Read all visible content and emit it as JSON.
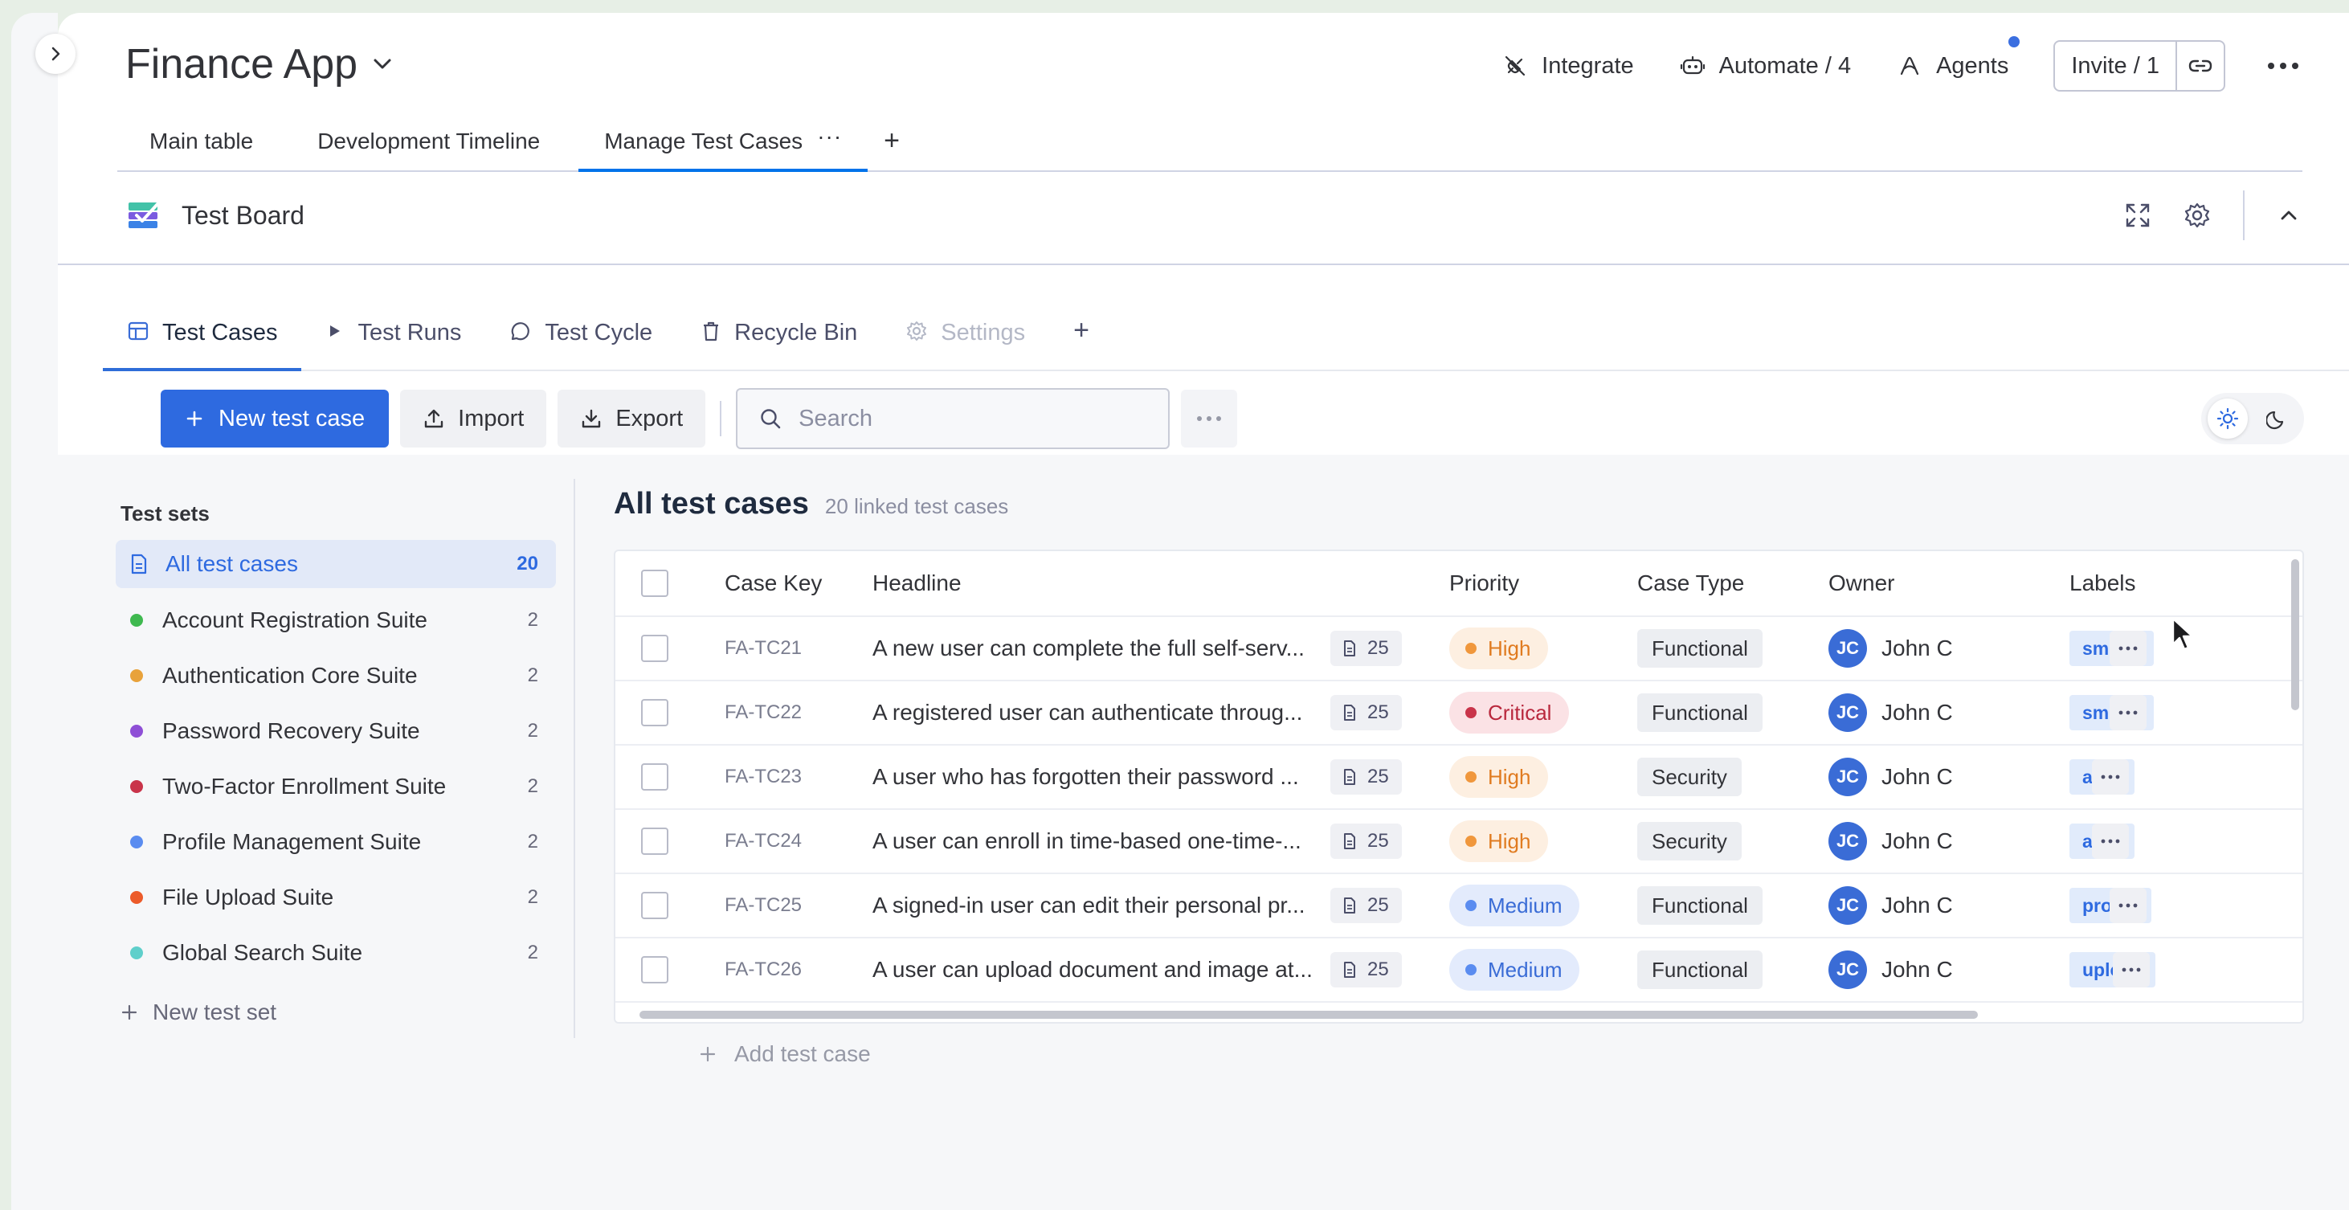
{
  "header": {
    "title": "Finance App",
    "actions": {
      "integrate": "Integrate",
      "automate": "Automate / 4",
      "agents": "Agents",
      "invite": "Invite / 1"
    }
  },
  "view_tabs": [
    {
      "label": "Main table"
    },
    {
      "label": "Development Timeline"
    },
    {
      "label": "Manage Test Cases"
    }
  ],
  "board": {
    "name": "Test Board"
  },
  "app_tabs": [
    {
      "label": "Test Cases"
    },
    {
      "label": "Test Runs"
    },
    {
      "label": "Test Cycle"
    },
    {
      "label": "Recycle Bin"
    },
    {
      "label": "Settings"
    }
  ],
  "toolbar": {
    "new_label": "New test case",
    "import_label": "Import",
    "export_label": "Export",
    "search_placeholder": "Search"
  },
  "sets": {
    "title": "Test sets",
    "items": [
      {
        "label": "All test cases",
        "count": "20",
        "color": ""
      },
      {
        "label": "Account Registration Suite",
        "count": "2",
        "color": "#3fb950"
      },
      {
        "label": "Authentication Core Suite",
        "count": "2",
        "color": "#e8a23b"
      },
      {
        "label": "Password Recovery Suite",
        "count": "2",
        "color": "#8e4fd6"
      },
      {
        "label": "Two-Factor Enrollment Suite",
        "count": "2",
        "color": "#c9344a"
      },
      {
        "label": "Profile Management Suite",
        "count": "2",
        "color": "#5a8cf0"
      },
      {
        "label": "File Upload Suite",
        "count": "2",
        "color": "#ec5b2a"
      },
      {
        "label": "Global Search Suite",
        "count": "2",
        "color": "#5fcfcb"
      }
    ],
    "new_label": "New test set"
  },
  "cases": {
    "title": "All test cases",
    "subtitle": "20 linked test cases",
    "columns": {
      "key": "Case Key",
      "headline": "Headline",
      "priority": "Priority",
      "type": "Case Type",
      "owner": "Owner",
      "labels": "Labels"
    },
    "rows": [
      {
        "key": "FA-TC21",
        "headline": "A new user can complete the full self-serv...",
        "steps": "25",
        "priority": "High",
        "prio_color": "#f0973c",
        "prio_bg": "#fdefe1",
        "prio_fg": "#e07b20",
        "type": "Functional",
        "owner_initials": "JC",
        "owner": "John C",
        "label": "smoke"
      },
      {
        "key": "FA-TC22",
        "headline": "A registered user can authenticate throug...",
        "steps": "25",
        "priority": "Critical",
        "prio_color": "#c9344a",
        "prio_bg": "#fbe2e5",
        "prio_fg": "#b9283d",
        "type": "Functional",
        "owner_initials": "JC",
        "owner": "John C",
        "label": "smoke"
      },
      {
        "key": "FA-TC23",
        "headline": "A user who has forgotten their password ...",
        "steps": "25",
        "priority": "High",
        "prio_color": "#f0973c",
        "prio_bg": "#fdefe1",
        "prio_fg": "#e07b20",
        "type": "Security",
        "owner_initials": "JC",
        "owner": "John C",
        "label": "auth"
      },
      {
        "key": "FA-TC24",
        "headline": "A user can enroll in time-based one-time-...",
        "steps": "25",
        "priority": "High",
        "prio_color": "#f0973c",
        "prio_bg": "#fdefe1",
        "prio_fg": "#e07b20",
        "type": "Security",
        "owner_initials": "JC",
        "owner": "John C",
        "label": "auth"
      },
      {
        "key": "FA-TC25",
        "headline": "A signed-in user can edit their personal pr...",
        "steps": "25",
        "priority": "Medium",
        "prio_color": "#5a8cf0",
        "prio_bg": "#e3ebfc",
        "prio_fg": "#3a6cd6",
        "type": "Functional",
        "owner_initials": "JC",
        "owner": "John C",
        "label": "profile"
      },
      {
        "key": "FA-TC26",
        "headline": "A user can upload document and image at...",
        "steps": "25",
        "priority": "Medium",
        "prio_color": "#5a8cf0",
        "prio_bg": "#e3ebfc",
        "prio_fg": "#3a6cd6",
        "type": "Functional",
        "owner_initials": "JC",
        "owner": "John C",
        "label": "upload"
      }
    ],
    "add_label": "Add test case"
  }
}
